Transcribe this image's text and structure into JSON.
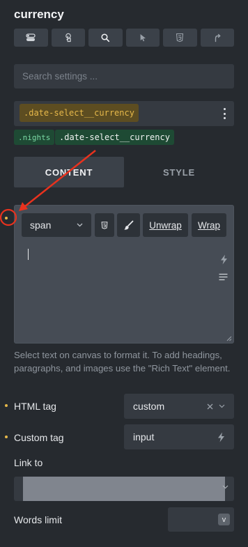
{
  "panel": {
    "title": "currency"
  },
  "iconbar": [
    "toggle-icon",
    "touch-icon",
    "search-icon",
    "cursor-icon",
    "html5-icon",
    "share-icon"
  ],
  "search": {
    "placeholder": "Search settings ..."
  },
  "selector": {
    "active_class": ".date-select__currency",
    "chips": [
      ".nights",
      ".date-select__currency"
    ]
  },
  "tabs": {
    "content": "CONTENT",
    "style": "STYLE"
  },
  "editor": {
    "tag_select": "span",
    "unwrap": "Unwrap",
    "wrap": "Wrap"
  },
  "help_text": "Select text on canvas to format it. To add headings, paragraphs, and images use the \"Rich Text\" element.",
  "controls": {
    "html_tag": {
      "label": "HTML tag",
      "value": "custom"
    },
    "custom_tag": {
      "label": "Custom tag",
      "value": "input"
    },
    "link_to": {
      "label": "Link to"
    },
    "words_limit": {
      "label": "Words limit",
      "spin": "v"
    }
  },
  "colors": {
    "background": "#262a2f",
    "accent": "#e6b84a",
    "annotation": "#e8321e",
    "chip_green": "#1e4a34"
  }
}
